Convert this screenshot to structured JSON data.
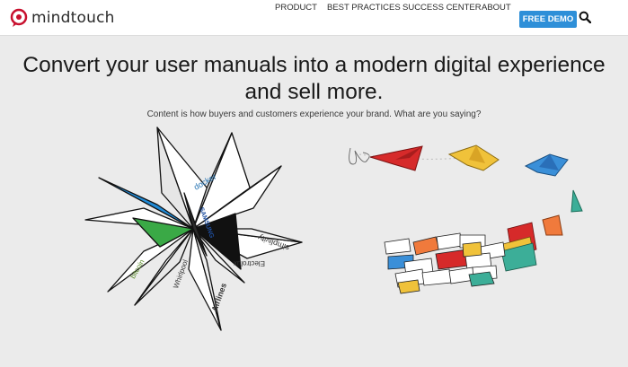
{
  "brand": {
    "name": "mindtouch",
    "logo_icon": "speech-bubble-logo-icon",
    "accent": "#c8102e"
  },
  "nav": {
    "items": [
      {
        "label": "PRODUCT"
      },
      {
        "label": "BEST PRACTICES"
      },
      {
        "label": "SUCCESS CENTER"
      },
      {
        "label": "ABOUT"
      }
    ],
    "cta_label": "FREE DEMO",
    "cta_color": "#2e8fd8",
    "search_icon": "search-icon"
  },
  "hero": {
    "headline_line1": "Convert your user manuals into a modern digital experience",
    "headline_line2": "and sell more.",
    "subhead": "Content is how buyers and customers experience your brand. What are you saying?"
  },
  "illustration": {
    "star_labels": [
      "docker",
      "SAMSUNG",
      "Electrolux",
      "simplivity",
      "Whirlpool",
      "Airlines",
      "bitcoin"
    ],
    "origami_colors": [
      "#d62a2a",
      "#f0c23a",
      "#3a8fd8",
      "#3cae98",
      "#f07a3c"
    ]
  }
}
